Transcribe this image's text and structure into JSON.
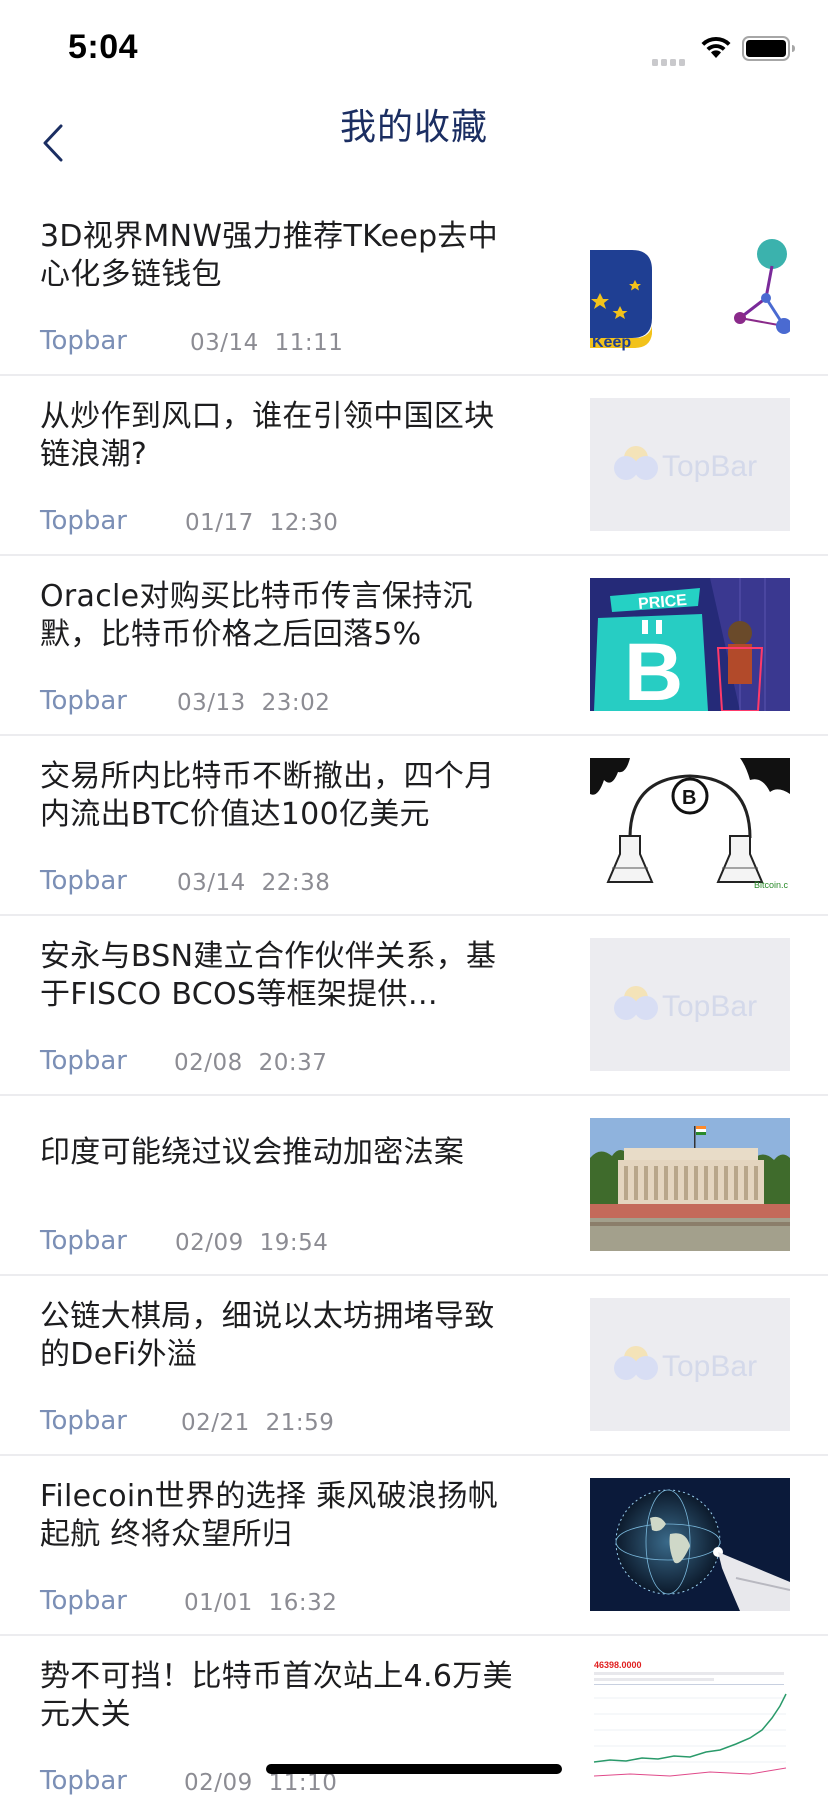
{
  "status_bar": {
    "time": "5:04",
    "icons": [
      "signal-icon",
      "wifi-icon",
      "battery-icon"
    ]
  },
  "nav": {
    "back_icon": "chevron-left-icon",
    "title": "我的收藏"
  },
  "colors": {
    "title": "#1b2e62",
    "source": "#7b8fb6",
    "time": "#8c8c93",
    "divider": "#ececef"
  },
  "news": [
    {
      "title": "3D视界MNW强力推荐TKeep去中心化多链钱包",
      "source": "Topbar",
      "time": "03/14  11:11",
      "thumbnail": "tkeep-wallet-image"
    },
    {
      "title": "从炒作到风口，谁在引领中国区块链浪潮?",
      "source": "Topbar",
      "time": "01/17  12:30",
      "thumbnail": "topbar-placeholder-image",
      "thumbnail_text": "TopBar"
    },
    {
      "title": "Oracle对购买比特币传言保持沉默，比特币价格之后回落5%",
      "source": "Topbar",
      "time": "03/13  23:02",
      "thumbnail": "bitcoin-price-sign-image",
      "thumbnail_text": "PRICE"
    },
    {
      "title": "交易所内比特币不断撤出，四个月内流出BTC价值达100亿美元",
      "source": "Topbar",
      "time": "03/14  22:38",
      "thumbnail": "bitcoin-flask-illustration-image",
      "thumbnail_text": "Bitcoin.c"
    },
    {
      "title": "安永与BSN建立合作伙伴关系，基于FISCO BCOS等框架提供…",
      "source": "Topbar",
      "time": "02/08  20:37",
      "thumbnail": "topbar-placeholder-image",
      "thumbnail_text": "TopBar"
    },
    {
      "title": "印度可能绕过议会推动加密法案",
      "source": "Topbar",
      "time": "02/09  19:54",
      "thumbnail": "india-parliament-photo"
    },
    {
      "title": "公链大棋局，细说以太坊拥堵导致的DeFi外溢",
      "source": "Topbar",
      "time": "02/21  21:59",
      "thumbnail": "topbar-placeholder-image",
      "thumbnail_text": "TopBar"
    },
    {
      "title": "Filecoin世界的选择 乘风破浪扬帆起航 终将众望所归",
      "source": "Topbar",
      "time": "01/01  16:32",
      "thumbnail": "digital-globe-hand-image"
    },
    {
      "title": "势不可挡！比特币首次站上4.6万美元大关",
      "source": "Topbar",
      "time": "02/09  11:10",
      "thumbnail": "price-chart-screenshot-image",
      "thumbnail_text": "46398.0000"
    }
  ]
}
